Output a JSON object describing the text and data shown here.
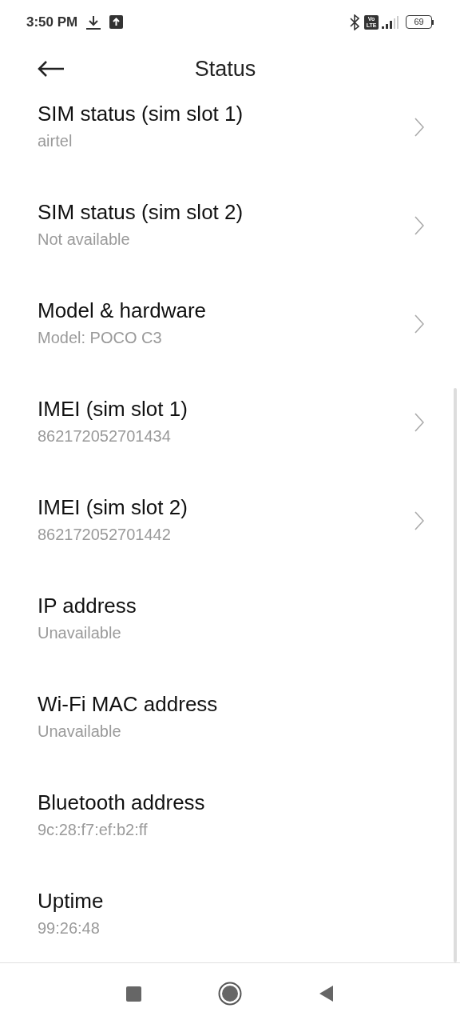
{
  "status_bar": {
    "time": "3:50 PM",
    "volte": {
      "top": "Vo",
      "bottom": "LTE"
    },
    "battery": "69"
  },
  "header": {
    "title": "Status"
  },
  "items": [
    {
      "kind": "link",
      "title": "SIM status (sim slot 1)",
      "value": "airtel"
    },
    {
      "kind": "link",
      "title": "SIM status (sim slot 2)",
      "value": "Not available"
    },
    {
      "kind": "link",
      "title": "Model & hardware",
      "value": "Model: POCO C3"
    },
    {
      "kind": "link",
      "title": "IMEI (sim slot 1)",
      "value": "862172052701434"
    },
    {
      "kind": "link",
      "title": "IMEI (sim slot 2)",
      "value": "862172052701442"
    },
    {
      "kind": "info",
      "title": "IP address",
      "value": "Unavailable"
    },
    {
      "kind": "info",
      "title": "Wi-Fi MAC address",
      "value": "Unavailable"
    },
    {
      "kind": "info",
      "title": "Bluetooth address",
      "value": "9c:28:f7:ef:b2:ff"
    },
    {
      "kind": "info",
      "title": "Uptime",
      "value": "99:26:48"
    }
  ]
}
